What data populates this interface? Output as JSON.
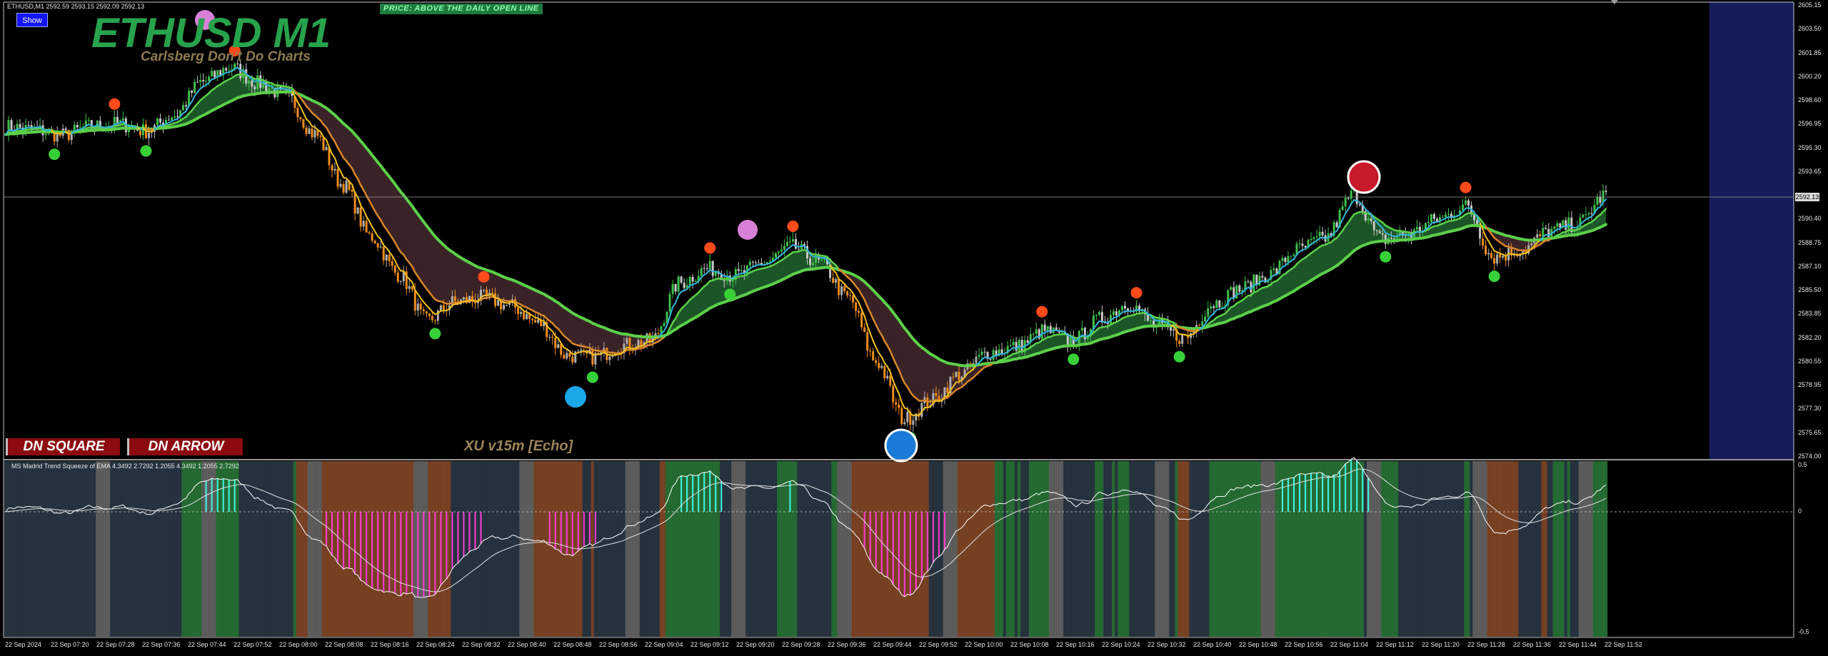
{
  "window": {
    "symbol_header": "ETHUSD,M1  2592.59 2593.15 2592.09 2592.13",
    "show_button": "Show",
    "banner": "PRICE: ABOVE THE DAILY OPEN LINE",
    "title": "ETHUSD M1",
    "subtitle": "Carlsberg Don't Do Charts",
    "dn_square": "DN SQUARE",
    "dn_arrow": "DN ARROW",
    "xu_label": "XU v15m [Echo]",
    "indicator_label": "MS Madrid Trend Squeeze of EMA  4.3492 2.7292 1.2055 4.3492 1.2055 2.7292",
    "current_price": "2592.13"
  },
  "colors": {
    "bull_fill": "#1e5a2a",
    "bear_fill": "#3d2528",
    "ema_slow": "#e8922a",
    "ema_fast_up": "#32b4d8",
    "ema_mid_up": "#5ccf4a",
    "ema_fast_dn": "#f0c020",
    "cyan_hist": "#3ff7e6",
    "magenta_hist": "#ff3ad7",
    "brown_bar": "#8a4a28",
    "slate_bar": "#2c3a48",
    "green_bar": "#2a7a3a",
    "session_shade": "#141d5a"
  },
  "price_axis": [
    "2605.15",
    "2603.50",
    "2601.85",
    "2600.20",
    "2598.60",
    "2596.95",
    "2595.30",
    "2593.65",
    "2592.13",
    "2590.40",
    "2588.75",
    "2587.10",
    "2585.50",
    "2583.85",
    "2582.20",
    "2580.55",
    "2578.95",
    "2577.30",
    "2575.65",
    "2574.00"
  ],
  "osc_axis": [
    "0.5",
    "0",
    "-0.5"
  ],
  "time_axis": [
    "22 Sep 2024",
    "22 Sep 07:20",
    "22 Sep 07:28",
    "22 Sep 07:36",
    "22 Sep 07:44",
    "22 Sep 07:52",
    "22 Sep 08:00",
    "22 Sep 08:08",
    "22 Sep 08:16",
    "22 Sep 08:24",
    "22 Sep 08:32",
    "22 Sep 08:40",
    "22 Sep 08:48",
    "22 Sep 08:56",
    "22 Sep 09:04",
    "22 Sep 09:12",
    "22 Sep 09:20",
    "22 Sep 09:28",
    "22 Sep 09:36",
    "22 Sep 09:44",
    "22 Sep 09:52",
    "22 Sep 10:00",
    "22 Sep 10:08",
    "22 Sep 10:16",
    "22 Sep 10:24",
    "22 Sep 10:32",
    "22 Sep 10:40",
    "22 Sep 10:48",
    "22 Sep 10:56",
    "22 Sep 11:04",
    "22 Sep 11:12",
    "22 Sep 11:20",
    "22 Sep 11:28",
    "22 Sep 11:36",
    "22 Sep 11:44",
    "22 Sep 11:52"
  ],
  "chart_data": {
    "type": "line",
    "series": [
      {
        "values": [
          2596.8,
          2596.6,
          2596.2,
          2596.8,
          2597.0,
          2596.5,
          2597.6,
          2599.9,
          2600.9,
          2599.8,
          2598.9,
          2596.3,
          2592.8,
          2589.2,
          2586.6,
          2583.4,
          2584.7,
          2585.0,
          2584.4,
          2583.2,
          2581.0,
          2580.9,
          2581.7,
          2582.0,
          2586.0,
          2587.0,
          2586.5,
          2587.4,
          2588.5,
          2587.4,
          2585.0,
          2580.6,
          2576.6,
          2577.9,
          2579.7,
          2581.2,
          2581.6,
          2582.7,
          2582.0,
          2583.5,
          2584.6,
          2583.0,
          2582.2,
          2584.6,
          2585.6,
          2586.6,
          2588.3,
          2589.1,
          2592.1,
          2589.0,
          2589.4,
          2590.4,
          2591.3,
          2587.8,
          2588.3,
          2589.6,
          2590.1,
          2592.1
        ]
      }
    ]
  }
}
